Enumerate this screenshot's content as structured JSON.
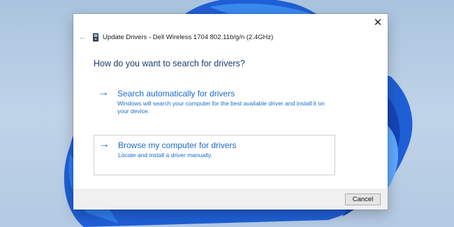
{
  "dialog": {
    "title": "Update Drivers - Dell Wireless 1704 802.11b/g/n (2.4GHz)",
    "close_icon": "close-icon",
    "back_icon": "back-arrow-icon",
    "device_icon": "device-icon",
    "heading": "How do you want to search for drivers?",
    "options": [
      {
        "title": "Search automatically for drivers",
        "description": "Windows will search your computer for the best available driver and install it on your device.",
        "icon": "arrow-right-icon"
      },
      {
        "title": "Browse my computer for drivers",
        "description": "Locate and install a driver manually.",
        "icon": "arrow-right-icon"
      }
    ],
    "cancel_label": "Cancel"
  },
  "colors": {
    "accent": "#1b6ac9",
    "heading": "#1e3a70",
    "wallpaper": "#aac4df",
    "bloom": "#1f5fd6"
  }
}
